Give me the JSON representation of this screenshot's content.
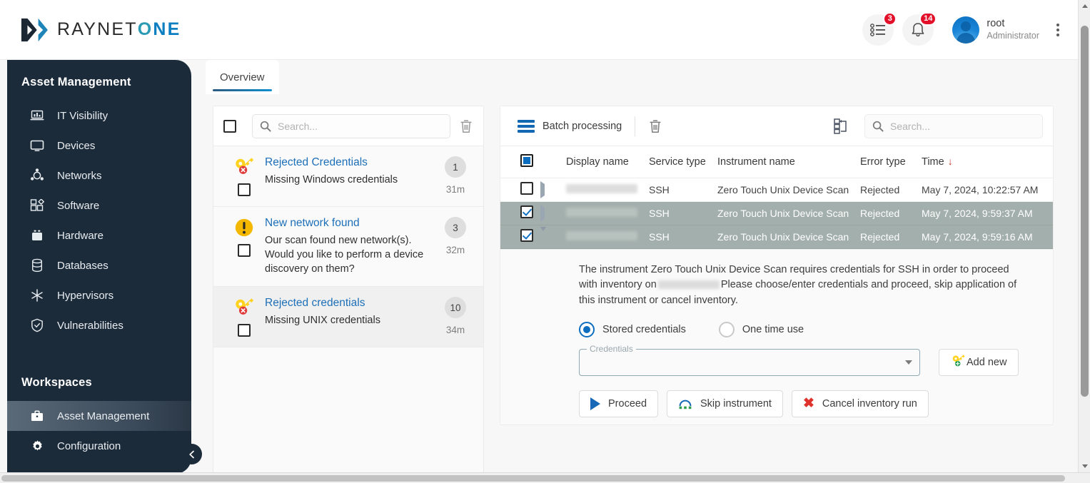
{
  "header": {
    "logo_text_1": "RAYNET",
    "logo_text_o": "O",
    "logo_text_ne": "NE",
    "tasks_badge": "3",
    "notifications_badge": "14",
    "user_name": "root",
    "user_role": "Administrator",
    "tasks_icon": "task-list-icon",
    "bell_icon": "bell-icon",
    "kebab_icon": "more-vertical-icon"
  },
  "sidebar": {
    "title": "Asset Management",
    "items": [
      {
        "label": "IT Visibility",
        "icon": "laptop-chart-icon"
      },
      {
        "label": "Devices",
        "icon": "monitor-icon"
      },
      {
        "label": "Networks",
        "icon": "network-nodes-icon"
      },
      {
        "label": "Software",
        "icon": "blocks-icon"
      },
      {
        "label": "Hardware",
        "icon": "hardware-case-icon"
      },
      {
        "label": "Databases",
        "icon": "database-icon"
      },
      {
        "label": "Hypervisors",
        "icon": "snowflake-icon"
      },
      {
        "label": "Vulnerabilities",
        "icon": "shield-check-icon"
      }
    ],
    "workspaces_title": "Workspaces",
    "workspaces": [
      {
        "label": "Asset Management",
        "icon": "briefcase-icon",
        "active": true
      },
      {
        "label": "Configuration",
        "icon": "gear-icon",
        "active": false
      }
    ],
    "collapse_icon": "chevron-left-icon"
  },
  "tabs": [
    {
      "label": "Overview",
      "active": true
    }
  ],
  "notifications_panel": {
    "search_placeholder": "Search...",
    "search_value": "",
    "search_icon": "search-icon",
    "delete_icon": "trash-icon",
    "select_all_checked": false,
    "items": [
      {
        "icon": "key-error-icon",
        "title": "Rejected Credentials",
        "description": "Missing Windows credentials",
        "count": "1",
        "age": "31m",
        "checked": false
      },
      {
        "icon": "warning-icon",
        "title": "New network found",
        "description": "Our scan found new network(s). Would you like to perform a device discovery on them?",
        "count": "3",
        "age": "32m",
        "checked": false
      },
      {
        "icon": "key-error-icon",
        "title": "Rejected credentials",
        "description": "Missing UNIX credentials",
        "count": "10",
        "age": "34m",
        "checked": false
      }
    ]
  },
  "table_panel": {
    "toolbar": {
      "batch_label": "Batch processing",
      "batch_icon": "batch-lines-icon",
      "delete_icon": "trash-icon",
      "tree_icon": "tree-structure-icon",
      "search_placeholder": "Search...",
      "search_value": "",
      "search_icon": "search-icon"
    },
    "columns": [
      "Display name",
      "Service type",
      "Instrument name",
      "Error type",
      "Time"
    ],
    "sort_column": "Time",
    "sort_direction": "desc",
    "header_checkbox_state": "indeterminate",
    "rows": [
      {
        "checked": false,
        "selected": false,
        "expanded": false,
        "display_name": "",
        "display_name_redacted": true,
        "service_type": "SSH",
        "instrument_name": "Zero Touch Unix Device Scan",
        "error_type": "Rejected",
        "time": "May 7, 2024, 10:22:57 AM"
      },
      {
        "checked": true,
        "selected": true,
        "expanded": false,
        "display_name": "",
        "display_name_redacted": true,
        "service_type": "SSH",
        "instrument_name": "Zero Touch Unix Device Scan",
        "error_type": "Rejected",
        "time": "May 7, 2024, 9:59:37 AM"
      },
      {
        "checked": true,
        "selected": true,
        "expanded": true,
        "display_name": "",
        "display_name_redacted": true,
        "service_type": "SSH",
        "instrument_name": "Zero Touch Unix Device Scan",
        "error_type": "Rejected",
        "time": "May 7, 2024, 9:59:16 AM"
      }
    ],
    "detail": {
      "text_part1": "The instrument Zero Touch Unix Device Scan requires credentials for SSH in order to proceed with inventory on",
      "text_part2": "Please choose/enter credentials and proceed, skip application of this instrument or cancel inventory.",
      "radio_stored_label": "Stored credentials",
      "radio_onetime_label": "One time use",
      "radio_selected": "stored",
      "credentials_legend": "Credentials",
      "credentials_value": "",
      "add_new_label": "Add new",
      "add_new_icon": "key-add-icon",
      "buttons": [
        {
          "label": "Proceed",
          "icon": "play-icon"
        },
        {
          "label": "Skip instrument",
          "icon": "skip-icon"
        },
        {
          "label": "Cancel inventory run",
          "icon": "x-mark-icon"
        }
      ]
    }
  },
  "colors": {
    "brand_dark": "#1c2b3a",
    "brand_blue": "#0d6dbf",
    "brand_cyan": "#2a9ab5",
    "badge_red": "#e3102a",
    "row_selected": "#a3afac",
    "link_blue": "#1d6fb8",
    "warning_yellow": "#f5b800"
  }
}
